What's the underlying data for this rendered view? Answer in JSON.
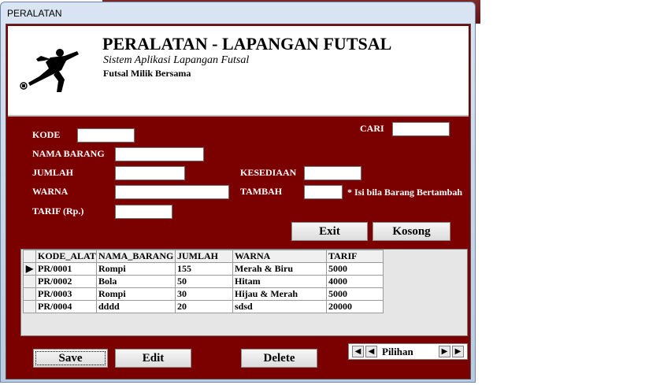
{
  "window": {
    "title": "PERALATAN"
  },
  "header": {
    "title": "PERALATAN - LAPANGAN FUTSAL",
    "subtitle": "Sistem Aplikasi Lapangan Futsal",
    "owner": "Futsal Milik Bersama"
  },
  "form": {
    "kode_label": "KODE",
    "nama_label": "NAMA BARANG",
    "jumlah_label": "JUMLAH",
    "warna_label": "WARNA",
    "tarif_label": "TARIF (Rp.)",
    "cari_label": "CARI",
    "kesediaan_label": "KESEDIAAN",
    "tambah_label": "TAMBAH",
    "tambah_hint": "* Isi bila Barang Bertambah",
    "kode_value": "",
    "nama_value": "",
    "jumlah_value": "",
    "warna_value": "",
    "tarif_value": "",
    "cari_value": "",
    "kesediaan_value": "",
    "tambah_value": ""
  },
  "buttons": {
    "exit": "Exit",
    "kosong": "Kosong",
    "save": "Save",
    "edit": "Edit",
    "delete": "Delete"
  },
  "grid": {
    "columns": [
      "KODE_ALAT",
      "NAMA_BARANG",
      "JUMLAH",
      "WARNA",
      "TARIF"
    ],
    "rows": [
      [
        "PR/0001",
        "Rompi",
        "155",
        "Merah & Biru",
        "5000"
      ],
      [
        "PR/0002",
        "Bola",
        "50",
        "Hitam",
        "4000"
      ],
      [
        "PR/0003",
        "Rompi",
        "30",
        "Hijau & Merah",
        "5000"
      ],
      [
        "PR/0004",
        "dddd",
        "20",
        "sdsd",
        "20000"
      ]
    ]
  },
  "navigator": {
    "caption": "Pilihan",
    "first_icon": "first-record-icon",
    "prev_icon": "prev-record-icon",
    "next_icon": "next-record-icon",
    "last_icon": "last-record-icon"
  },
  "colors": {
    "form_bg": "#7b0000",
    "label": "#ffffff"
  }
}
